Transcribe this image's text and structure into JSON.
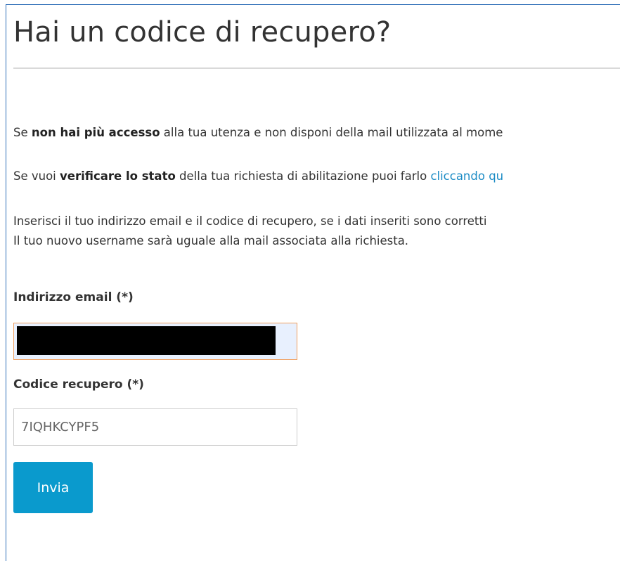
{
  "page": {
    "title": "Hai un codice di recupero?"
  },
  "intro": {
    "p1_a": "Se ",
    "p1_b": "non hai più accesso",
    "p1_c": " alla tua utenza e non disponi della mail utilizzata al mome",
    "p2_a": "Se vuoi ",
    "p2_b": "verificare lo stato",
    "p2_c": " della tua richiesta di abilitazione puoi farlo ",
    "p2_link": "cliccando qu",
    "p3_line1": "Inserisci il tuo indirizzo email e il codice di recupero, se i dati inseriti sono corretti",
    "p3_line2": "Il tuo nuovo username sarà uguale alla mail associata alla richiesta."
  },
  "form": {
    "email_label": "Indirizzo email (*)",
    "email_value": "",
    "code_label": "Codice recupero (*)",
    "code_value": "7IQHKCYPF5",
    "submit_label": "Invia"
  },
  "colors": {
    "accent": "#0a9acd",
    "link": "#1a8bc5",
    "focus_border": "#f0a060",
    "autofill_bg": "#e8f0fe"
  }
}
